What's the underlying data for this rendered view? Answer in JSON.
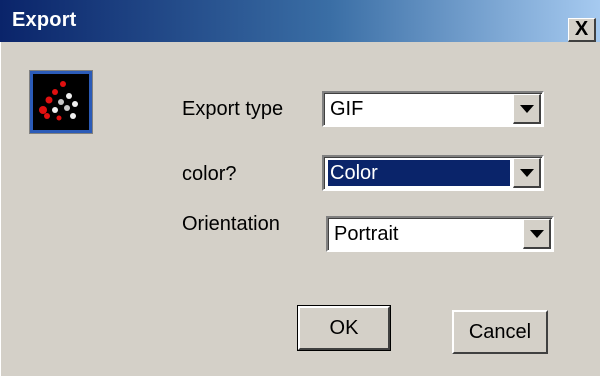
{
  "window": {
    "title": "Export",
    "close_glyph": "X"
  },
  "icon": {
    "name": "export-scatter-icon"
  },
  "fields": {
    "export_type": {
      "label": "Export type",
      "value": "GIF"
    },
    "color": {
      "label": "color?",
      "value": "Color"
    },
    "orientation": {
      "label": "Orientation",
      "value": "Portrait"
    }
  },
  "buttons": {
    "ok_label": "OK",
    "cancel_label": "Cancel"
  },
  "colors": {
    "title_gradient_start": "#0a246a",
    "title_gradient_end": "#a6caf0",
    "dialog_bg": "#d4d0c8",
    "selection_bg": "#0a246a"
  }
}
